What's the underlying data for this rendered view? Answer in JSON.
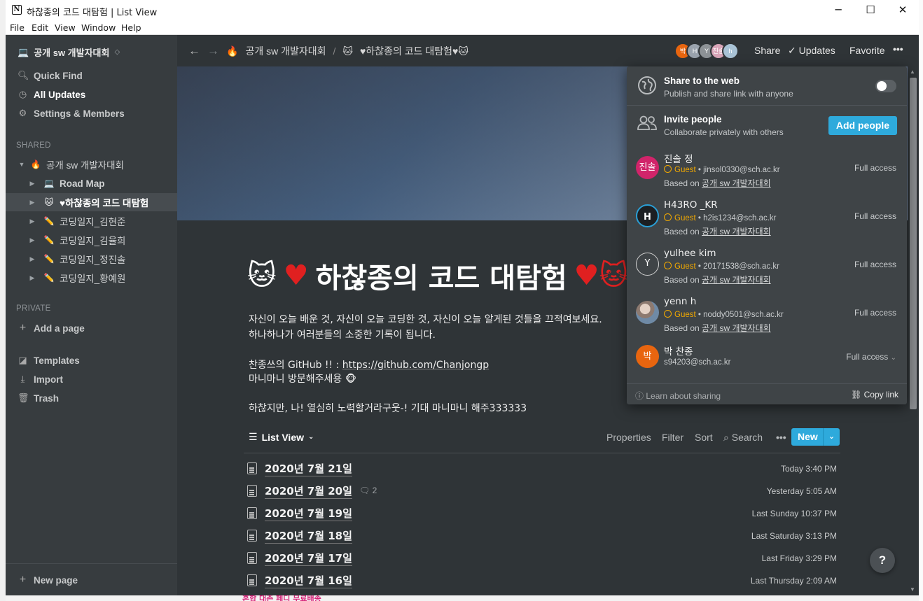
{
  "window": {
    "title": "하찮종의 코드 대탐험 | List View",
    "app_logo": "N",
    "minimize": "─",
    "maximize": "☐",
    "close": "✕"
  },
  "menu": [
    "File",
    "Edit",
    "View",
    "Window",
    "Help"
  ],
  "sidebar": {
    "workspace_icon": "💻",
    "workspace": "공개 sw 개발자대회",
    "workspace_caret": "⌃⌄",
    "quick_find": "Quick Find",
    "all_updates": "All Updates",
    "settings": "Settings & Members",
    "shared_header": "SHARED",
    "tree": [
      {
        "icon": "🔥",
        "label": "공개 sw 개발자대회"
      },
      {
        "icon": "💻",
        "label": "Road Map"
      },
      {
        "icon": "🐱",
        "label": "♥하찮종의 코드 대탐험"
      },
      {
        "icon": "✏️",
        "label": "코딩일지_김현준"
      },
      {
        "icon": "✏️",
        "label": "코딩일지_김율희"
      },
      {
        "icon": "✏️",
        "label": "코딩일지_정진솔"
      },
      {
        "icon": "✏️",
        "label": "코딩일지_황예원"
      }
    ],
    "private_header": "PRIVATE",
    "add_page": "Add a page",
    "templates": "Templates",
    "import": "Import",
    "trash": "Trash",
    "new_page": "New page"
  },
  "topbar": {
    "crumb1_icon": "🔥",
    "crumb1": "공개 sw 개발자대회",
    "crumb_sep": "/",
    "crumb2_icon": "🐱",
    "crumb2": "♥하찮종의 코드 대탐험♥🐱",
    "avatars": [
      "박",
      "H",
      "Y",
      "진솔",
      "h"
    ],
    "share": "Share",
    "updates": "Updates",
    "favorite": "Favorite",
    "more": "•••"
  },
  "page": {
    "title_icon": "🐱",
    "title_heart": "♥",
    "title": "하찮종의 코드 대탐험",
    "title_tail": "♥🐱",
    "desc1": "자신이 오늘 배운 것, 자신이 오늘 코딩한 것, 자신이 오늘 알게된 것들을 끄적여보세요.",
    "desc2": "하나하나가 여러분들의 소중한 기록이 됩니다.",
    "github_prefix": "찬종쓰의 GitHub !! : ",
    "github_link": "https://github.com/Chanjongp",
    "visit": "마니마니 방문해주세용 🐵",
    "motto": "하찮지만, 나! 열심히 노력할거라구웃-! 기대 마니마니 해주333333"
  },
  "list_view": {
    "label": "List View",
    "properties": "Properties",
    "filter": "Filter",
    "sort": "Sort",
    "search": "Search",
    "more": "•••",
    "new": "New",
    "rows": [
      {
        "title": "2020년 7월 21일",
        "comments": "",
        "time": "Today 3:40 PM"
      },
      {
        "title": "2020년 7월 20일",
        "comments": "2",
        "time": "Yesterday 5:05 AM"
      },
      {
        "title": "2020년 7월 19일",
        "comments": "",
        "time": "Last Sunday 10:37 PM"
      },
      {
        "title": "2020년 7월 18일",
        "comments": "",
        "time": "Last Saturday 3:13 PM"
      },
      {
        "title": "2020년 7월 17일",
        "comments": "",
        "time": "Last Friday 3:29 PM"
      },
      {
        "title": "2020년 7월 16일",
        "comments": "",
        "time": "Last Thursday 2:09 AM"
      }
    ]
  },
  "share_popup": {
    "web_title": "Share to the web",
    "web_sub": "Publish and share link with anyone",
    "invite_title": "Invite people",
    "invite_sub": "Collaborate privately with others",
    "add_people": "Add people",
    "members": [
      {
        "avatar": "진솔",
        "name": "진솔 정",
        "role": "Guest",
        "email": "jinsol0330@sch.ac.kr",
        "based_prefix": "Based on ",
        "based": "공개 sw 개발자대회",
        "access": "Full access",
        "color": "#d1246a"
      },
      {
        "avatar": "H",
        "name": "H43RO _KR",
        "role": "Guest",
        "email": "h2is1234@sch.ac.kr",
        "based_prefix": "Based on ",
        "based": "공개 sw 개발자대회",
        "access": "Full access",
        "color": "#1c1f22"
      },
      {
        "avatar": "Y",
        "name": "yulhee kim",
        "role": "Guest",
        "email": "20171538@sch.ac.kr",
        "based_prefix": "Based on ",
        "based": "공개 sw 개발자대회",
        "access": "Full access",
        "color": "#3f4447"
      },
      {
        "avatar": "",
        "name": "yenn h",
        "role": "Guest",
        "email": "noddy0501@sch.ac.kr",
        "based_prefix": "Based on ",
        "based": "공개 sw 개발자대회",
        "access": "Full access",
        "color": "#7c8a9a"
      },
      {
        "avatar": "박",
        "name": "박 찬종",
        "role": "",
        "email": "s94203@sch.ac.kr",
        "based_prefix": "",
        "based": "",
        "access": "Full access",
        "color": "#e8650f"
      }
    ],
    "learn": "Learn about sharing",
    "copy_link": "Copy link"
  },
  "help": "?",
  "desktop_peek": "혼합 대존 페디 무료배송",
  "colors": {
    "accent": "#2eaadc",
    "bg": "#2f3437",
    "sidebar": "#373c3f",
    "guest": "#f2a900"
  }
}
